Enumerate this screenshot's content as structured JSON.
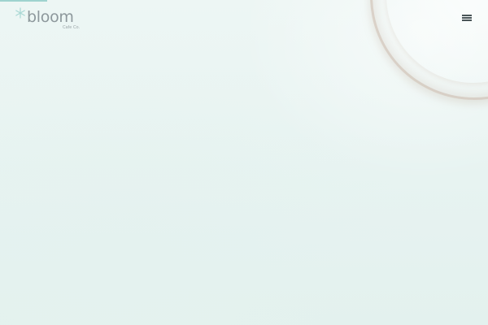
{
  "header": {
    "logo": {
      "wordmark": "bloom",
      "tagline": "Cafe Co.",
      "icon": "asterisk-star-icon"
    },
    "menu_icon": "hamburger-menu-icon"
  },
  "hero": {
    "scroll_progress": 0.1
  },
  "colors": {
    "background": "#e9f4f2",
    "accent": "#9fd3cf",
    "logo_text": "#8d989c",
    "menu_icon": "#4a5558"
  }
}
